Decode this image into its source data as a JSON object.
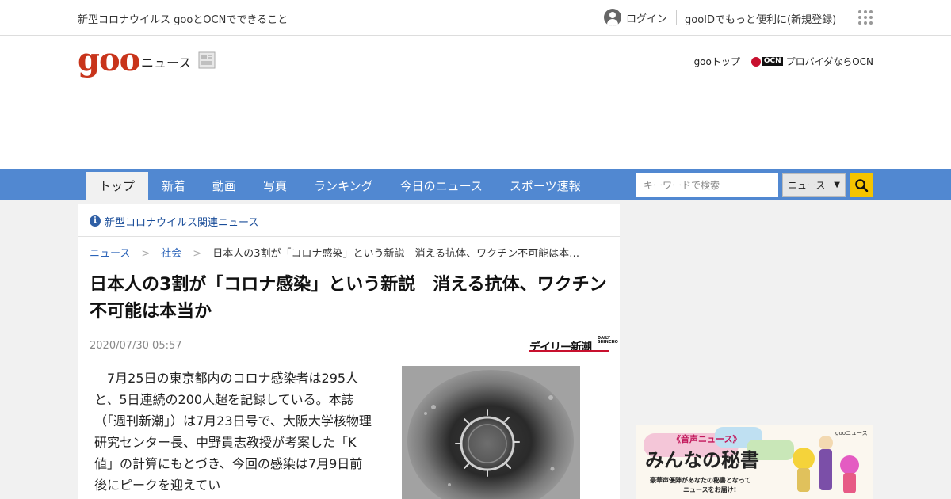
{
  "topbar": {
    "promo": "新型コロナウイルス gooとOCNでできること",
    "login": "ログイン",
    "register": "gooIDでもっと便利に(新規登録)"
  },
  "header": {
    "logo": "goo",
    "section": "ニュース",
    "links": {
      "goo_top": "gooトップ",
      "ocn_mark": "OCN",
      "ocn": "プロバイダならOCN"
    }
  },
  "nav": {
    "tabs": [
      "トップ",
      "新着",
      "動画",
      "写真",
      "ランキング",
      "今日のニュース",
      "スポーツ速報"
    ],
    "active_tab": "トップ",
    "search_placeholder": "キーワードで検索",
    "search_scope": "ニュース",
    "search_scope_caret": "▼"
  },
  "notice": {
    "icon": "i",
    "link": "新型コロナウイルス関連ニュース"
  },
  "breadcrumb": {
    "items": [
      "ニュース",
      "社会"
    ],
    "current": "日本人の3割が「コロナ感染」という新説　消える抗体、ワクチン不可能は本…",
    "separator": ">"
  },
  "article": {
    "title": "日本人の3割が「コロナ感染」という新説　消える抗体、ワクチン不可能は本当か",
    "date": "2020/07/30 05:57",
    "source": {
      "name": "デイリー新潮",
      "sub_line1": "DAILY",
      "sub_line2": "SHINCHO"
    },
    "paragraph": "　7月25日の東京都内のコロナ感染者は295人と、5日連続の200人超を記録している。本誌（「週刊新潮」）は7月23日号で、大阪大学核物理研究センター長、中野貴志教授が考案した「K値」の計算にもとづき、今回の感染は7月9日前後にピークを迎えてい"
  },
  "ad": {
    "tag": "《音声ニュース》",
    "brand": "gooニュース",
    "headline": "みんなの秘書",
    "subline1": "豪華声優陣があなたの秘書となって",
    "subline2": "ニュースをお届け!"
  },
  "colors": {
    "brand_red": "#c8341b",
    "nav_blue": "#5188d1",
    "search_yellow": "#f5c400",
    "link_blue": "#2b63b8"
  }
}
